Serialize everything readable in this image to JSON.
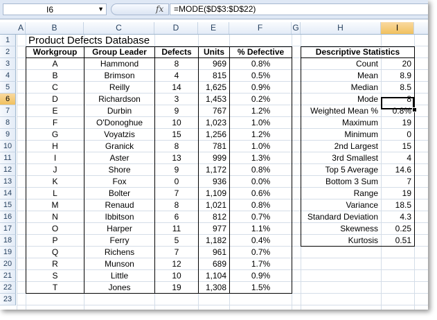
{
  "formula_bar": {
    "name_box": "I6",
    "fx_label": "fx",
    "formula": "=MODE($D$3:$D$22)"
  },
  "columns": [
    "A",
    "B",
    "C",
    "D",
    "E",
    "F",
    "G",
    "H",
    "I"
  ],
  "rows": [
    "1",
    "2",
    "3",
    "4",
    "5",
    "6",
    "7",
    "8",
    "9",
    "10",
    "11",
    "12",
    "13",
    "14",
    "15",
    "16",
    "17",
    "18",
    "19",
    "20",
    "21",
    "22",
    "23"
  ],
  "title": "Product Defects Database",
  "headers": [
    "Workgroup",
    "Group Leader",
    "Defects",
    "Units",
    "% Defective"
  ],
  "table": [
    [
      "A",
      "Hammond",
      "8",
      "969",
      "0.8%"
    ],
    [
      "B",
      "Brimson",
      "4",
      "815",
      "0.5%"
    ],
    [
      "C",
      "Reilly",
      "14",
      "1,625",
      "0.9%"
    ],
    [
      "D",
      "Richardson",
      "3",
      "1,453",
      "0.2%"
    ],
    [
      "E",
      "Durbin",
      "9",
      "767",
      "1.2%"
    ],
    [
      "F",
      "O'Donoghue",
      "10",
      "1,023",
      "1.0%"
    ],
    [
      "G",
      "Voyatzis",
      "15",
      "1,256",
      "1.2%"
    ],
    [
      "H",
      "Granick",
      "8",
      "781",
      "1.0%"
    ],
    [
      "I",
      "Aster",
      "13",
      "999",
      "1.3%"
    ],
    [
      "J",
      "Shore",
      "9",
      "1,172",
      "0.8%"
    ],
    [
      "K",
      "Fox",
      "0",
      "936",
      "0.0%"
    ],
    [
      "L",
      "Bolter",
      "7",
      "1,109",
      "0.6%"
    ],
    [
      "M",
      "Renaud",
      "8",
      "1,021",
      "0.8%"
    ],
    [
      "N",
      "Ibbitson",
      "6",
      "812",
      "0.7%"
    ],
    [
      "O",
      "Harper",
      "11",
      "977",
      "1.1%"
    ],
    [
      "P",
      "Ferry",
      "5",
      "1,182",
      "0.4%"
    ],
    [
      "Q",
      "Richens",
      "7",
      "961",
      "0.7%"
    ],
    [
      "R",
      "Munson",
      "12",
      "689",
      "1.7%"
    ],
    [
      "S",
      "Little",
      "10",
      "1,104",
      "0.9%"
    ],
    [
      "T",
      "Jones",
      "19",
      "1,308",
      "1.5%"
    ]
  ],
  "stats_title": "Descriptive Statistics",
  "stats": [
    [
      "Count",
      "20"
    ],
    [
      "Mean",
      "8.9"
    ],
    [
      "Median",
      "8.5"
    ],
    [
      "Mode",
      "8"
    ],
    [
      "Weighted Mean %",
      "0.8%"
    ],
    [
      "Maximum",
      "19"
    ],
    [
      "Minimum",
      "0"
    ],
    [
      "2nd Largest",
      "15"
    ],
    [
      "3rd Smallest",
      "4"
    ],
    [
      "Top 5 Average",
      "14.6"
    ],
    [
      "Bottom 3 Sum",
      "7"
    ],
    [
      "Range",
      "19"
    ],
    [
      "Variance",
      "18.5"
    ],
    [
      "Standard Deviation",
      "4.3"
    ],
    [
      "Skewness",
      "0.25"
    ],
    [
      "Kurtosis",
      "0.51"
    ]
  ],
  "selection": {
    "column": "I",
    "row": "6"
  }
}
